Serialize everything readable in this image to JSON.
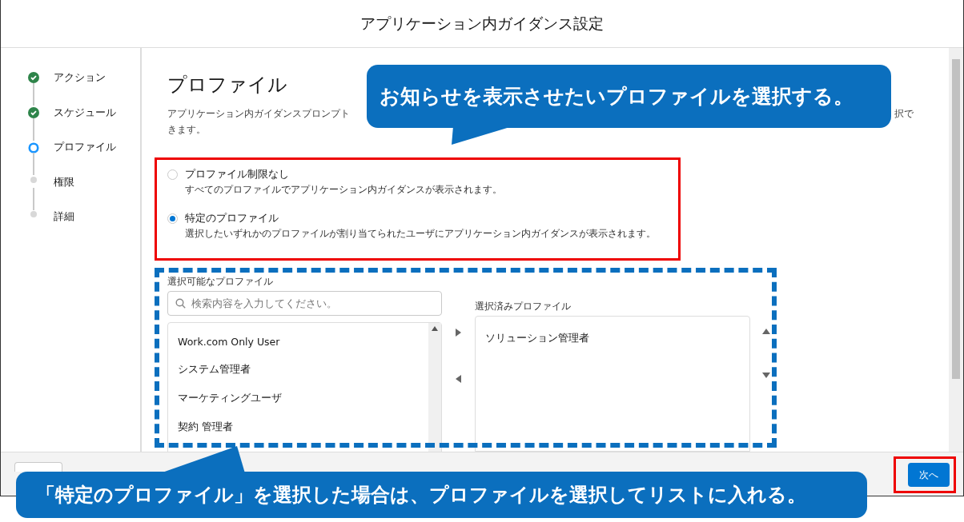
{
  "window": {
    "title": "アプリケーション内ガイダンス設定"
  },
  "steps": [
    {
      "label": "アクション",
      "kind": "complete"
    },
    {
      "label": "スケジュール",
      "kind": "complete"
    },
    {
      "label": "プロファイル",
      "kind": "current"
    },
    {
      "label": "権限",
      "kind": "upcoming"
    },
    {
      "label": "詳細",
      "kind": "upcoming"
    }
  ],
  "content": {
    "title": "プロファイル",
    "description_start": "アプリケーション内ガイダンスプロンプト",
    "description_end": "択で",
    "description_line2": "きます。",
    "options": [
      {
        "label": "プロファイル制限なし",
        "help": "すべてのプロファイルでアプリケーション内ガイダンスが表示されます。",
        "selected": false
      },
      {
        "label": "特定のプロファイル",
        "help": "選択したいずれかのプロファイルが割り当てられたユーザにアプリケーション内ガイダンスが表示されます。",
        "selected": true
      }
    ],
    "available": {
      "label": "選択可能なプロファイル",
      "search": {
        "placeholder": "検索内容を入力してください。"
      },
      "items": [
        "Work.com Only User",
        "システム管理者",
        "マーケティングユーザ",
        "契約 管理者"
      ]
    },
    "chosen": {
      "label": "選択済みプロファイル",
      "items": [
        "ソリューション管理者"
      ]
    }
  },
  "footer": {
    "next_button": "次へ"
  },
  "annotations": [
    {
      "kind": "highlight"
    },
    {
      "kind": "dashed"
    },
    {
      "kind": "highlight_next"
    },
    {
      "kind": "callout_top",
      "text": "お知らせを表示させたいプロファイルを選択する。"
    },
    {
      "kind": "callout_bottom",
      "text": "「特定のプロファイル」を選択した場合は、プロファイルを選択してリストに入れる。"
    }
  ]
}
